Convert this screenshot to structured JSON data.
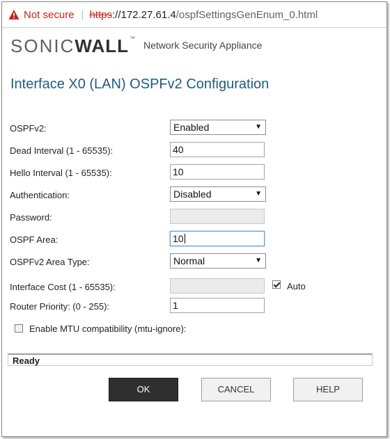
{
  "browser": {
    "security_label": "Not secure",
    "url_scheme": "https",
    "url_host": "://172.27.61.4",
    "url_path": "/ospfSettingsGenEnum_0.html",
    "warning_color": "#c5221f"
  },
  "brand": {
    "logo_light": "SONIC",
    "logo_bold": "WALL",
    "logo_tm": "™",
    "tagline": "Network Security Appliance"
  },
  "page_title": "Interface X0 (LAN) OSPFv2 Configuration",
  "form": {
    "ospfv2": {
      "label": "OSPFv2:",
      "value": "Enabled"
    },
    "dead_interval": {
      "label": "Dead Interval (1 - 65535):",
      "value": "40"
    },
    "hello_interval": {
      "label": "Hello Interval (1 - 65535):",
      "value": "10"
    },
    "authentication": {
      "label": "Authentication:",
      "value": "Disabled"
    },
    "password": {
      "label": "Password:",
      "value": ""
    },
    "ospf_area": {
      "label": "OSPF Area:",
      "value": "10"
    },
    "area_type": {
      "label": "OSPFv2 Area Type:",
      "value": "Normal"
    },
    "interface_cost": {
      "label": "Interface Cost (1 - 65535):",
      "value": "",
      "auto_label": "Auto",
      "auto_checked": true
    },
    "router_priority": {
      "label": "Router Priority: (0 - 255):",
      "value": "1"
    },
    "mtu_ignore": {
      "label": "Enable MTU compatibility (mtu-ignore):",
      "checked": false
    }
  },
  "status": "Ready",
  "buttons": {
    "ok": "OK",
    "cancel": "CANCEL",
    "help": "HELP"
  },
  "colors": {
    "title": "#1f5b80",
    "ok_button_bg": "#2f2f2f"
  }
}
